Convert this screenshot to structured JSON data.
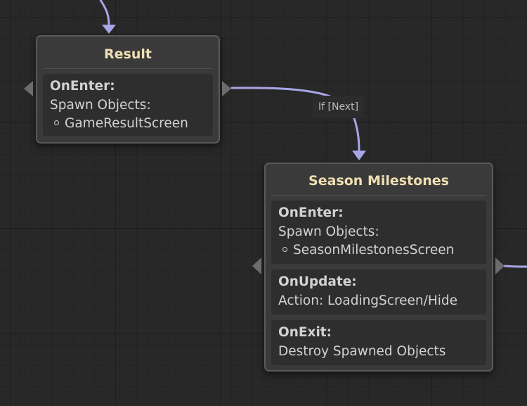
{
  "graph": {
    "edge_label": "If [Next]"
  },
  "nodes": {
    "result": {
      "title": "Result",
      "on_enter": {
        "header": "OnEnter:",
        "spawn_label": "Spawn Objects:",
        "objects": [
          "GameResultScreen"
        ]
      }
    },
    "season_milestones": {
      "title": "Season Milestones",
      "on_enter": {
        "header": "OnEnter:",
        "spawn_label": "Spawn Objects:",
        "objects": [
          "SeasonMilestonesScreen"
        ]
      },
      "on_update": {
        "header": "OnUpdate:",
        "action": "Action: LoadingScreen/Hide"
      },
      "on_exit": {
        "header": "OnExit:",
        "action": "Destroy Spawned Objects"
      }
    }
  },
  "colors": {
    "edge": "#a8a6e6",
    "title": "#efdfb3",
    "node_bg": "#3a3a3a",
    "section_bg": "#2e2e2e",
    "canvas_bg": "#282828"
  }
}
